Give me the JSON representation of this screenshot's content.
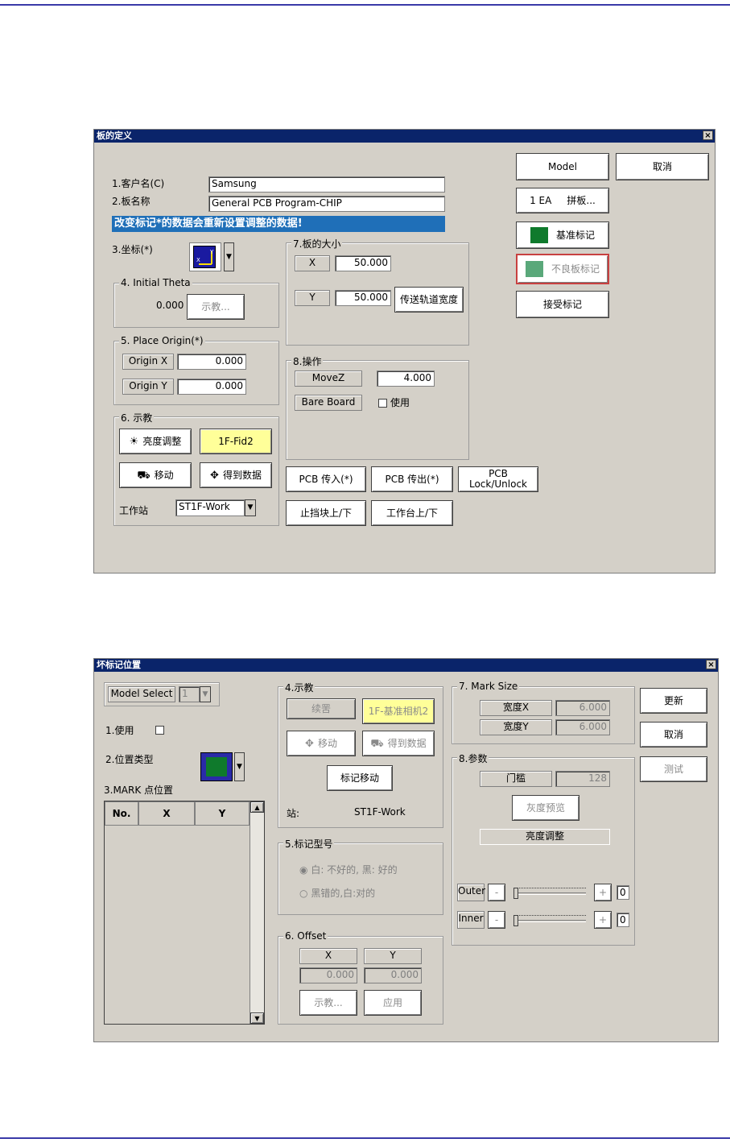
{
  "dialog1": {
    "title": "板的定义",
    "close": "×",
    "customer_label": "1.客户名(C)",
    "customer_value": "Samsung",
    "board_label": "2.板名称",
    "board_value": "General PCB Program-CHIP",
    "warning": "改变标记*的数据会重新设置调整的数据!",
    "coord_label": "3.坐标(*)",
    "theta": {
      "title": "4. Initial Theta",
      "value": "0.000",
      "teach": "示教..."
    },
    "place_origin": {
      "title": "5. Place Origin(*)",
      "origin_x_label": "Origin X",
      "origin_x": "0.000",
      "origin_y_label": "Origin Y",
      "origin_y": "0.000"
    },
    "teach": {
      "title": "6. 示教",
      "brightness": "亮度调整",
      "fid": "1F-Fid2",
      "move": "移动",
      "get_data": "得到数据",
      "station_label": "工作站",
      "station_value": "ST1F-Work"
    },
    "board_size": {
      "title": "7.板的大小",
      "x_label": "X",
      "x_value": "50.000",
      "y_label": "Y",
      "y_value": "50.000",
      "conveyor_width": "传送轨道宽度"
    },
    "operation": {
      "title": "8.操作",
      "movez_label": "MoveZ",
      "movez_value": "4.000",
      "bare_board_label": "Bare Board",
      "use_label": "使用"
    },
    "buttons": {
      "pcb_in": "PCB 传入(*)",
      "pcb_out": "PCB 传出(*)",
      "pcb_lock": "PCB\nLock/Unlock",
      "stopper": "止挡块上/下",
      "table": "工作台上/下"
    },
    "right": {
      "model": "Model",
      "cancel": "取消",
      "array": "1 EA     拼板...",
      "fiducial": "基准标记",
      "bad_mark": "不良板标记",
      "accept": "接受标记"
    }
  },
  "dialog2": {
    "title": "坏标记位置",
    "close": "×",
    "model_select_label": "Model Select",
    "model_select_value": "1",
    "use_label": "1.使用",
    "pos_type_label": "2.位置类型",
    "mark_pos_label": "3.MARK 点位置",
    "table_headers": [
      "No.",
      "X",
      "Y"
    ],
    "teach": {
      "title": "4.示教",
      "continue": "续罟",
      "camera": "1F-基准相机2",
      "move": "移动",
      "get_data": "得到数据",
      "mark_move": "标记移动",
      "station_label": "站:",
      "station_value": "ST1F-Work"
    },
    "mark_type": {
      "title": "5.标记型号",
      "opt1": "白: 不好的, 黑: 好的",
      "opt2": "黑错的,白:对的"
    },
    "offset": {
      "title": "6. Offset",
      "x_label": "X",
      "y_label": "Y",
      "x_value": "0.000",
      "y_value": "0.000",
      "teach": "示教...",
      "apply": "应用"
    },
    "mark_size": {
      "title": "7. Mark Size",
      "width_x_label": "宽度X",
      "width_x": "6.000",
      "width_y_label": "宽度Y",
      "width_y": "6.000"
    },
    "params": {
      "title": "8.参数",
      "threshold_label": "门槛",
      "threshold": "128",
      "gray_preview": "灰度预览",
      "brightness": "亮度调整",
      "outer_label": "Outer",
      "inner_label": "Inner",
      "minus": "-",
      "plus": "+",
      "outer_value": "0",
      "inner_value": "0"
    },
    "right": {
      "update": "更新",
      "cancel": "取消",
      "test": "测试"
    }
  }
}
